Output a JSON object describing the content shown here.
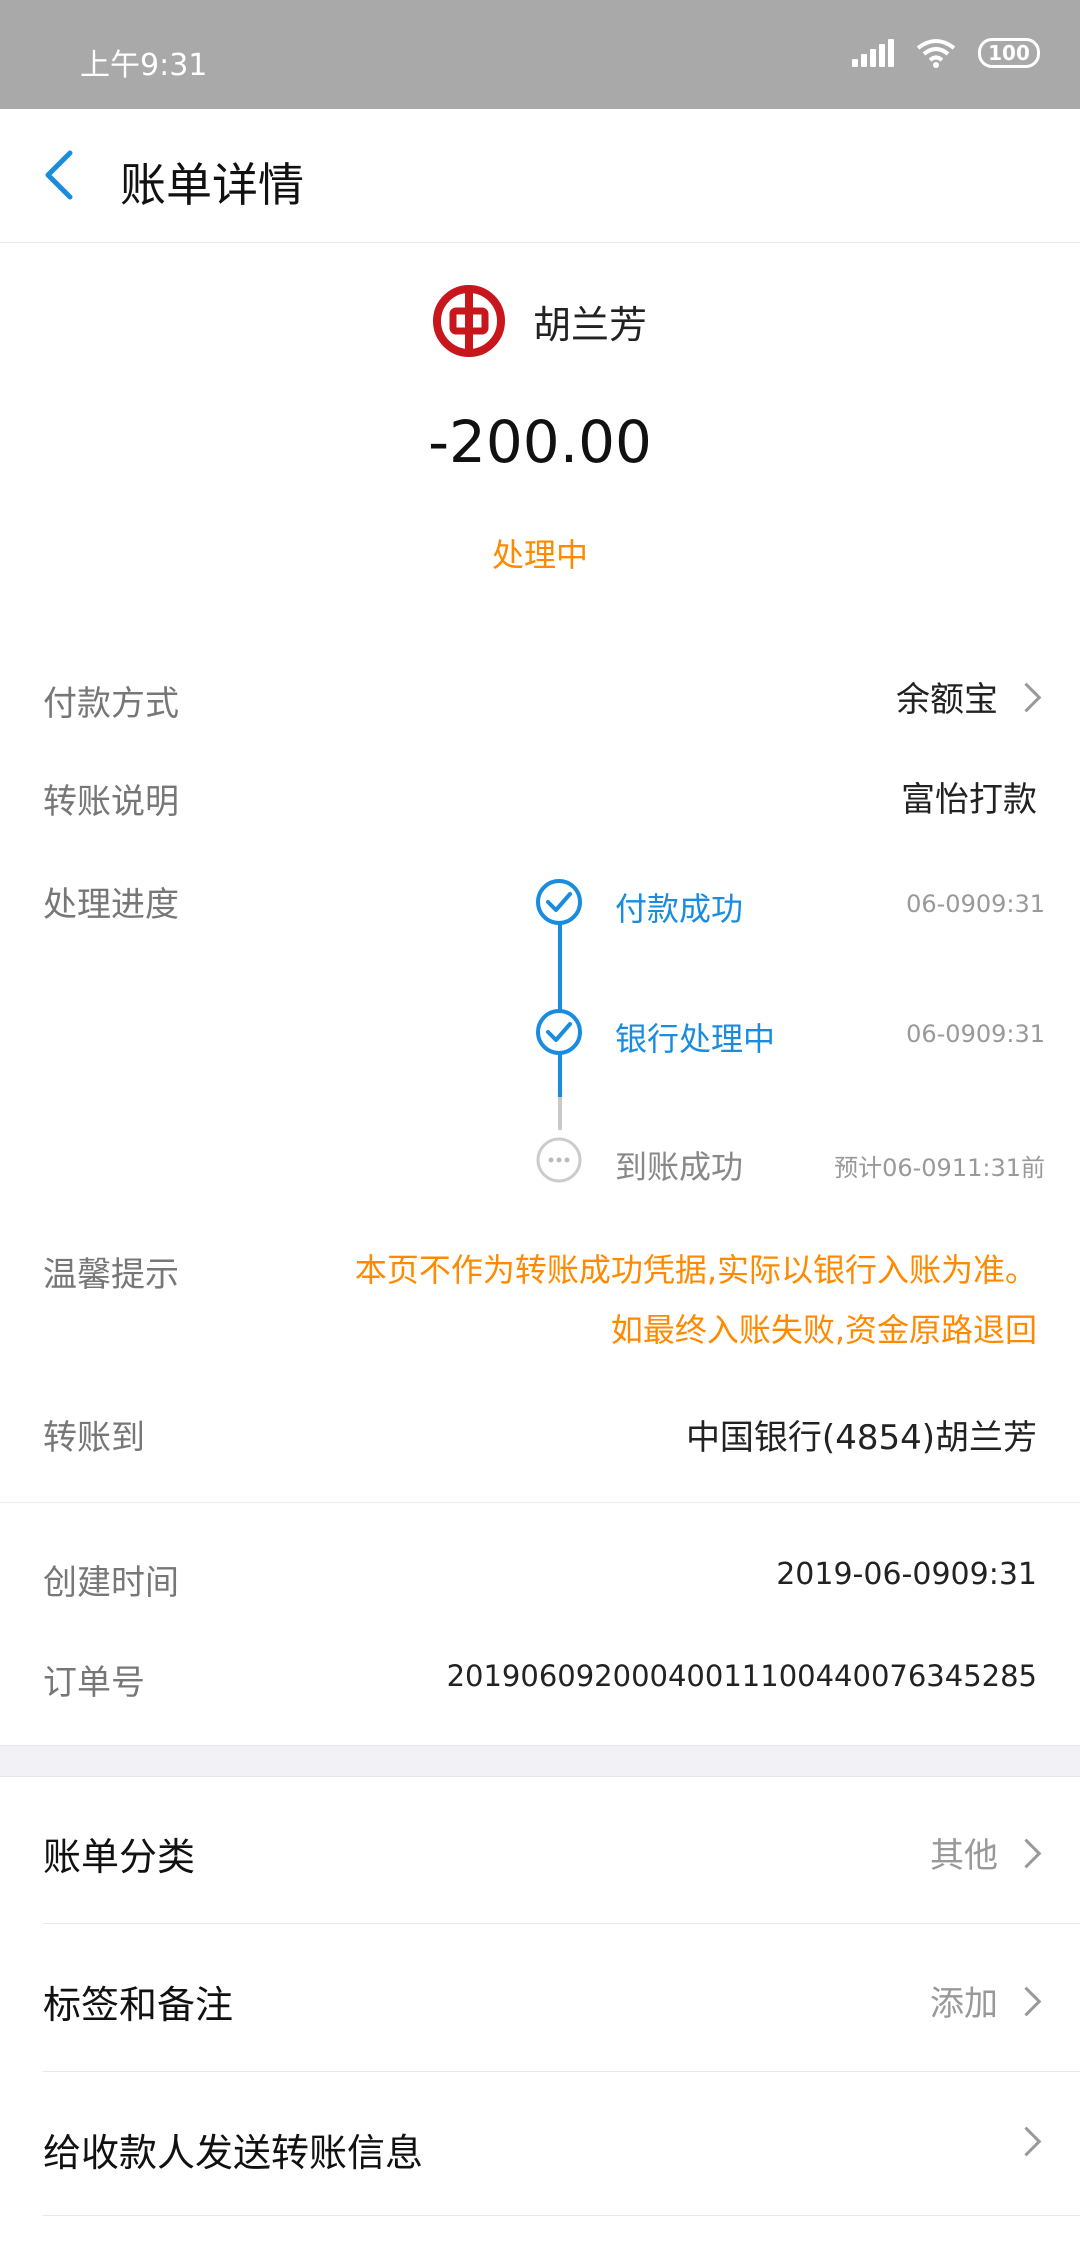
{
  "status_bar": {
    "time": "上午9:31",
    "battery": "100"
  },
  "header": {
    "title": "账单详情"
  },
  "summary": {
    "payee": "胡兰芳",
    "amount": "-200.00",
    "status": "处理中"
  },
  "details": {
    "payment_method_label": "付款方式",
    "payment_method_value": "余额宝",
    "transfer_note_label": "转账说明",
    "transfer_note_value": "富怡打款",
    "progress_label": "处理进度",
    "progress": [
      {
        "label": "付款成功",
        "time": "06-0909:31"
      },
      {
        "label": "银行处理中",
        "time": "06-0909:31"
      },
      {
        "label": "到账成功",
        "time": "预计06-0911:31前"
      }
    ],
    "tip_label": "温馨提示",
    "tip_line1": "本页不作为转账成功凭据,实际以银行入账为准。",
    "tip_line2": "如最终入账失败,资金原路退回",
    "transfer_to_label": "转账到",
    "transfer_to_value": "中国银行(4854)胡兰芳",
    "created_label": "创建时间",
    "created_value": "2019-06-0909:31",
    "order_label": "订单号",
    "order_value": "20190609200040011100440076345285"
  },
  "actions": {
    "category_label": "账单分类",
    "category_value": "其他",
    "tags_label": "标签和备注",
    "tags_value": "添加",
    "send_label": "给收款人发送转账信息"
  },
  "colors": {
    "accent_blue": "#1a8ce0",
    "orange": "#ff8a00",
    "bank_red": "#c8161d"
  }
}
